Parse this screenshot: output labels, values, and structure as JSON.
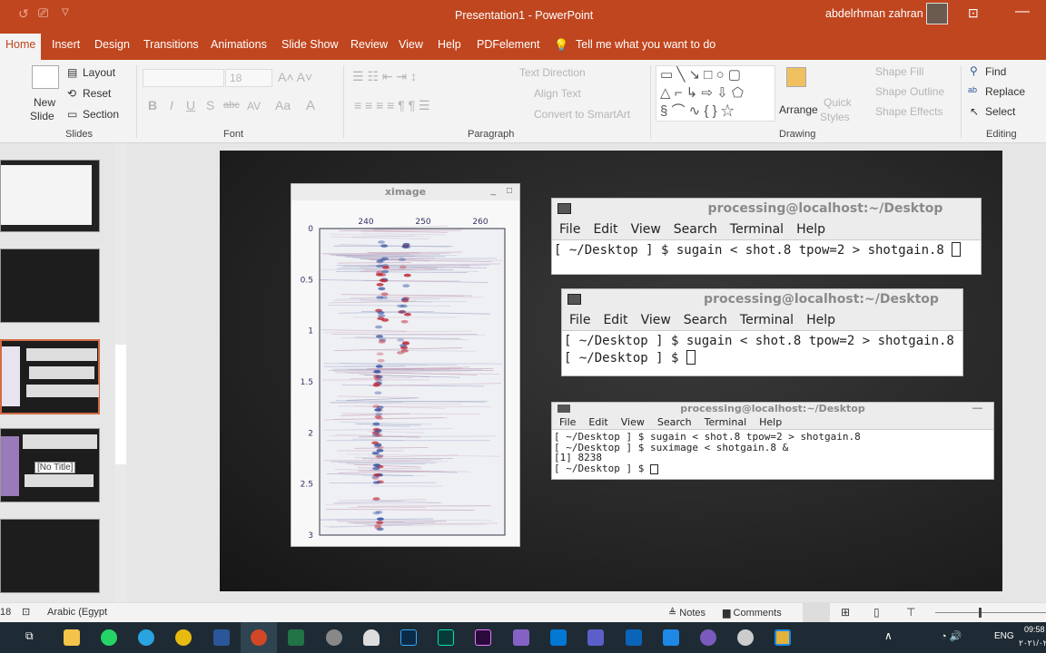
{
  "app": {
    "title": "Presentation1  -  PowerPoint",
    "user": "abdelrhman zahran",
    "accent": "#c0461f"
  },
  "tabs": [
    {
      "label": "Home",
      "active": true
    },
    {
      "label": "Insert"
    },
    {
      "label": "Design"
    },
    {
      "label": "Transitions"
    },
    {
      "label": "Animations"
    },
    {
      "label": "Slide Show"
    },
    {
      "label": "Review"
    },
    {
      "label": "View"
    },
    {
      "label": "Help"
    },
    {
      "label": "PDFelement"
    }
  ],
  "tell_me": "Tell me what you want to do",
  "ribbon": {
    "slides": {
      "new_slide": "New",
      "new_slide2": "Slide",
      "layout": "Layout",
      "reset": "Reset",
      "section": "Section",
      "label": "Slides"
    },
    "font": {
      "size": "18",
      "label": "Font"
    },
    "paragraph": {
      "text_direction": "Text Direction",
      "align_text": "Align Text",
      "convert": "Convert to SmartArt",
      "label": "Paragraph"
    },
    "drawing": {
      "arrange": "Arrange",
      "quick_styles": "Quick",
      "quick_styles2": "Styles",
      "shape_fill": "Shape Fill",
      "shape_outline": "Shape Outline",
      "shape_effects": "Shape Effects",
      "label": "Drawing"
    },
    "editing": {
      "find": "Find",
      "replace": "Replace",
      "select": "Select",
      "label": "Editing"
    }
  },
  "thumb_tooltip": "[No Title]",
  "ximage": {
    "title": "ximage",
    "x_ticks": [
      "240",
      "250",
      "260"
    ],
    "y_ticks": [
      "0",
      "0.5",
      "1",
      "1.5",
      "2",
      "2.5",
      "3"
    ]
  },
  "terminals": [
    {
      "title": "processing@localhost:~/Desktop",
      "menu": [
        "File",
        "Edit",
        "View",
        "Search",
        "Terminal",
        "Help"
      ],
      "lines": [
        "[ ~/Desktop ] $ sugain < shot.8 tpow=2 > shotgain.8 "
      ]
    },
    {
      "title": "processing@localhost:~/Desktop",
      "menu": [
        "File",
        "Edit",
        "View",
        "Search",
        "Terminal",
        "Help"
      ],
      "lines": [
        "[ ~/Desktop ] $ sugain < shot.8 tpow=2 > shotgain.8",
        "[ ~/Desktop ] $ "
      ]
    },
    {
      "title": "processing@localhost:~/Desktop",
      "menu": [
        "File",
        "Edit",
        "View",
        "Search",
        "Terminal",
        "Help"
      ],
      "lines": [
        "[ ~/Desktop ] $ sugain < shot.8 tpow=2 > shotgain.8",
        "[ ~/Desktop ] $ suximage < shotgain.8 &",
        "[1] 8238",
        "[ ~/Desktop ] $ "
      ]
    }
  ],
  "status": {
    "slide": "18",
    "language": "Arabic (Egypt",
    "notes": "Notes",
    "comments": "Comments"
  },
  "taskbar": {
    "lang": "ENG",
    "time": "09:58",
    "date": "٢٠٢١/٠٢/٠٢"
  }
}
